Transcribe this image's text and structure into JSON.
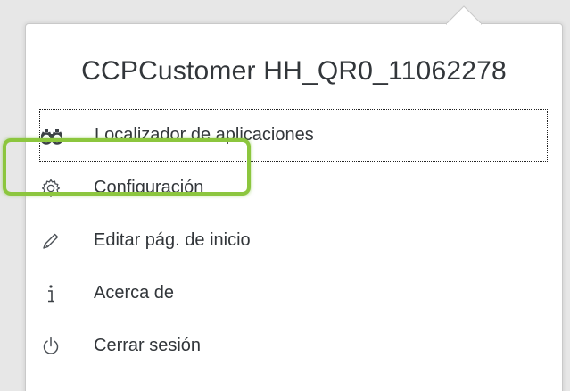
{
  "popover": {
    "title": "CCPCustomer HH_QR0_11062278"
  },
  "menu": {
    "items": [
      {
        "label": "Localizador de aplicaciones",
        "icon": "binoculars-icon"
      },
      {
        "label": "Configuración",
        "icon": "gear-icon"
      },
      {
        "label": "Editar pág. de inicio",
        "icon": "pencil-icon"
      },
      {
        "label": "Acerca de",
        "icon": "info-icon"
      },
      {
        "label": "Cerrar sesión",
        "icon": "power-icon"
      }
    ]
  },
  "colors": {
    "highlight": "#8cc63e",
    "text": "#32363a",
    "background": "#e7e7e7"
  }
}
